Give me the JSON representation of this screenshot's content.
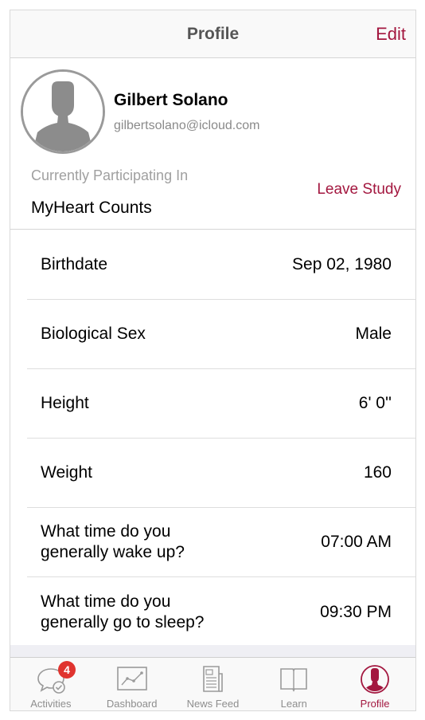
{
  "navbar": {
    "title": "Profile",
    "edit_label": "Edit"
  },
  "profile": {
    "name": "Gilbert Solano",
    "email": "gilbertsolano@icloud.com",
    "participating_label": "Currently Participating In",
    "study_name": "MyHeart Counts",
    "leave_label": "Leave Study"
  },
  "rows": [
    {
      "label": "Birthdate",
      "value": "Sep 02, 1980"
    },
    {
      "label": "Biological Sex",
      "value": "Male"
    },
    {
      "label": "Height",
      "value": "6' 0''"
    },
    {
      "label": "Weight",
      "value": "160"
    },
    {
      "label": "What time do you generally wake up?",
      "label_line1": "What time do you",
      "label_line2": "generally wake up?",
      "value": "07:00 AM"
    },
    {
      "label": "What time do you generally go to sleep?",
      "label_line1": "What time do you",
      "label_line2": "generally go to sleep?",
      "value": "09:30 PM"
    }
  ],
  "tabs": [
    {
      "label": "Activities",
      "icon": "activities-icon",
      "badge": "4"
    },
    {
      "label": "Dashboard",
      "icon": "dashboard-icon"
    },
    {
      "label": "News Feed",
      "icon": "news-feed-icon"
    },
    {
      "label": "Learn",
      "icon": "learn-icon"
    },
    {
      "label": "Profile",
      "icon": "profile-icon",
      "active": true
    }
  ],
  "colors": {
    "accent": "#a3173f",
    "badge": "#e0342f"
  }
}
